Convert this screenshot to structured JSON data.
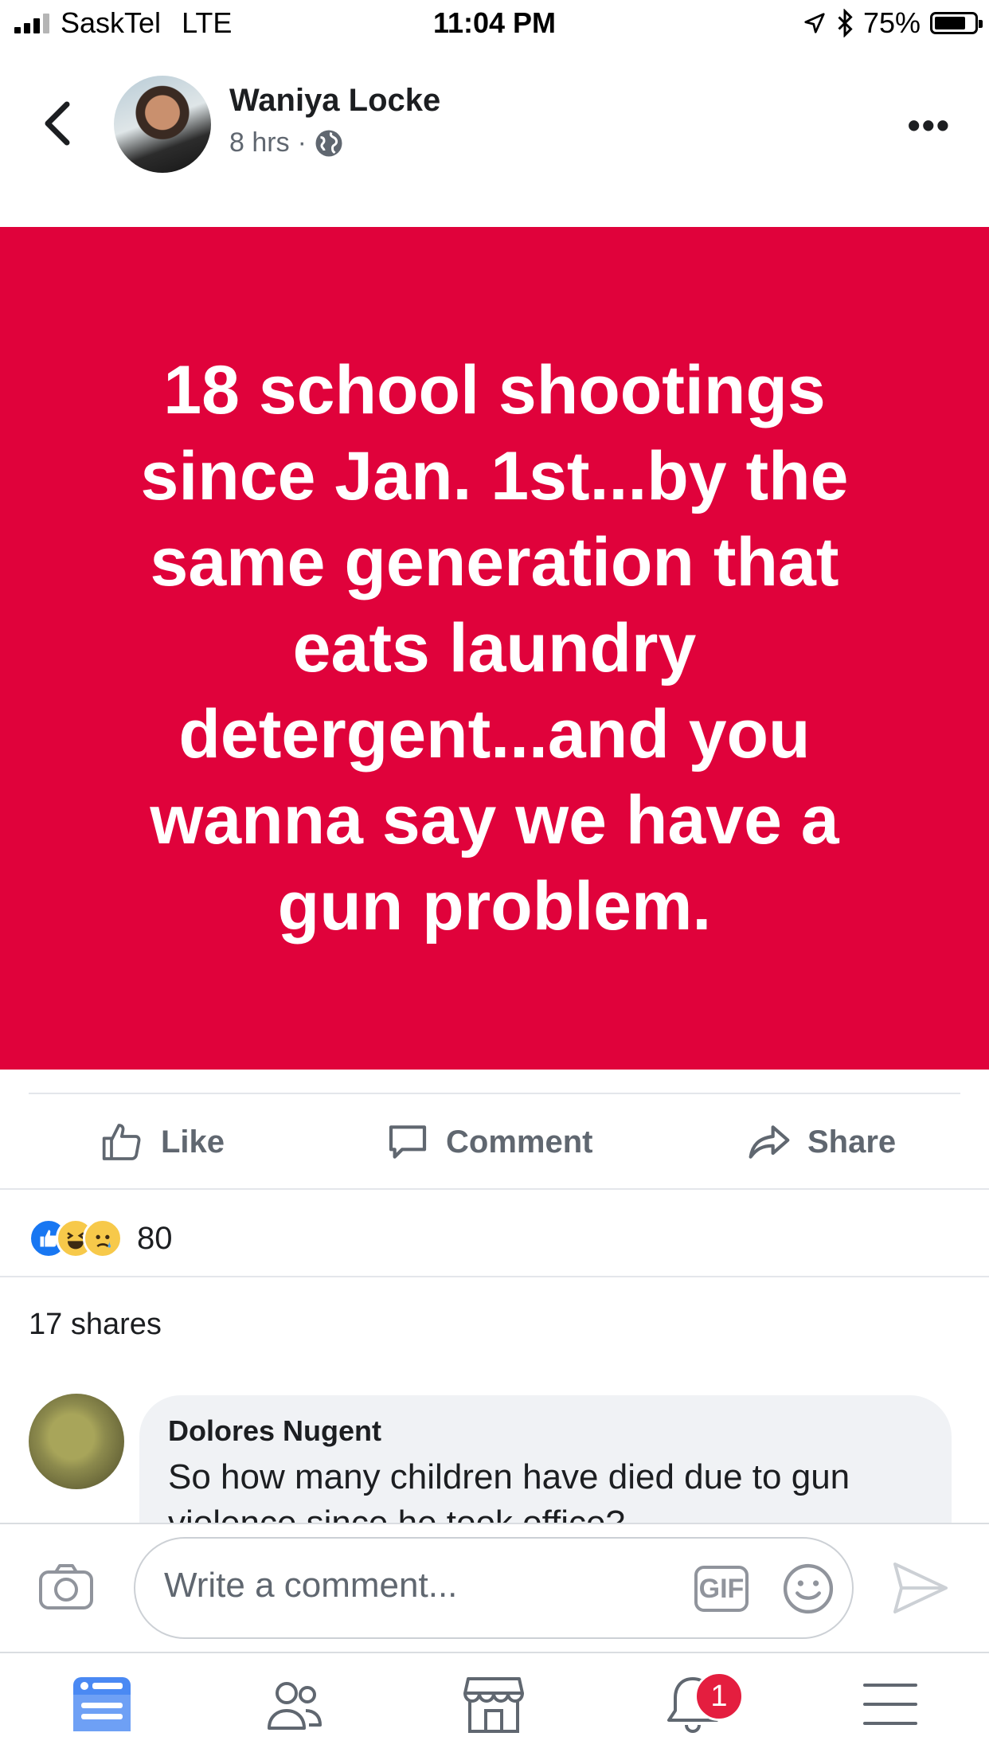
{
  "status_bar": {
    "carrier": "SaskTel",
    "network": "LTE",
    "time": "11:04 PM",
    "battery": "75%",
    "battery_level": 0.75
  },
  "post": {
    "author": "Waniya Locke",
    "time_ago": "8 hrs",
    "separator": "·",
    "privacy_icon": "globe-icon",
    "text": "18 school shootings since Jan. 1st...by the same generation that eats laundry detergent...and you wanna say we have a gun problem.",
    "background_color": "#e0023b"
  },
  "actions": {
    "like": "Like",
    "comment": "Comment",
    "share": "Share"
  },
  "reactions": {
    "types": [
      "like",
      "haha",
      "sad"
    ],
    "count": "80"
  },
  "shares": "17 shares",
  "comment": {
    "author": "Dolores Nugent",
    "text": "So how many children have died due to gun violence since he took office?"
  },
  "composer": {
    "placeholder": "Write a comment...",
    "gif_label": "GIF"
  },
  "tabbar": {
    "items": [
      "news-feed",
      "friends",
      "marketplace",
      "notifications",
      "menu"
    ],
    "notifications_badge": "1",
    "accent": "#4a89f3"
  }
}
